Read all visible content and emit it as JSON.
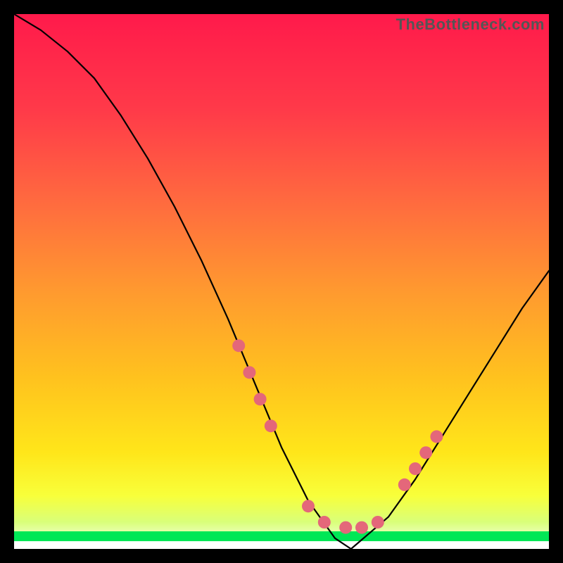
{
  "watermark": "TheBottleneck.com",
  "chart_data": {
    "type": "line",
    "title": "",
    "xlabel": "",
    "ylabel": "",
    "xlim": [
      0,
      100
    ],
    "ylim": [
      0,
      100
    ],
    "grid": false,
    "legend": false,
    "background_gradient": {
      "top_color": "#ff1a4b",
      "mid_color": "#ffd400",
      "bottom_green_band": "#00e756",
      "bottom_white_band": "#ffffff"
    },
    "series": [
      {
        "name": "bottleneck-curve",
        "stroke": "#000000",
        "x": [
          0,
          5,
          10,
          15,
          20,
          25,
          30,
          35,
          40,
          45,
          50,
          55,
          60,
          63,
          70,
          75,
          80,
          85,
          90,
          95,
          100
        ],
        "values": [
          100,
          97,
          93,
          88,
          81,
          73,
          64,
          54,
          43,
          31,
          19,
          9,
          2,
          0,
          6,
          13,
          21,
          29,
          37,
          45,
          52
        ]
      }
    ],
    "markers": {
      "name": "highlight-dots",
      "color": "#e4677a",
      "radius_px": 9,
      "points": [
        {
          "x": 42,
          "y": 38
        },
        {
          "x": 44,
          "y": 33
        },
        {
          "x": 46,
          "y": 28
        },
        {
          "x": 48,
          "y": 23
        },
        {
          "x": 55,
          "y": 8
        },
        {
          "x": 58,
          "y": 5
        },
        {
          "x": 62,
          "y": 4
        },
        {
          "x": 65,
          "y": 4
        },
        {
          "x": 68,
          "y": 5
        },
        {
          "x": 73,
          "y": 12
        },
        {
          "x": 75,
          "y": 15
        },
        {
          "x": 77,
          "y": 18
        },
        {
          "x": 79,
          "y": 21
        }
      ]
    }
  }
}
